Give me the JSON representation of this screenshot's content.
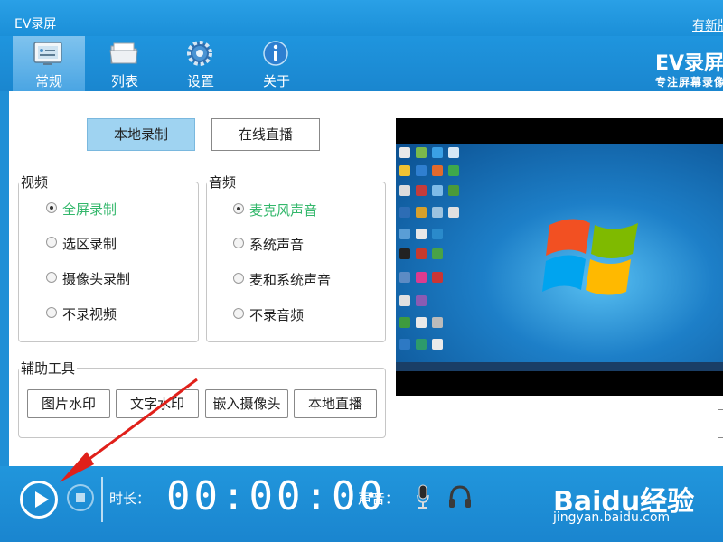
{
  "window": {
    "title": "EV录屏",
    "update_link": "有新版"
  },
  "tabs": [
    {
      "label": "常规",
      "icon": "general-icon"
    },
    {
      "label": "列表",
      "icon": "folder-icon"
    },
    {
      "label": "设置",
      "icon": "gear-icon"
    },
    {
      "label": "关于",
      "icon": "info-icon"
    }
  ],
  "brand": {
    "title": "EV录屏",
    "subtitle": "专注屏幕录像"
  },
  "mode_buttons": {
    "local": "本地录制",
    "live": "在线直播"
  },
  "video": {
    "title": "视频",
    "options": [
      "全屏录制",
      "选区录制",
      "摄像头录制",
      "不录视频"
    ],
    "selected": "全屏录制"
  },
  "audio": {
    "title": "音频",
    "options": [
      "麦克风声音",
      "系统声音",
      "麦和系统声音",
      "不录音频"
    ],
    "selected": "麦克风声音"
  },
  "tools": {
    "title": "辅助工具",
    "buttons": [
      "图片水印",
      "文字水印",
      "嵌入摄像头",
      "本地直播"
    ]
  },
  "bottom": {
    "duration_label": "时长：",
    "timer": "00:00:00",
    "sound_label": "声音："
  },
  "watermark": {
    "logo": "Baidu经验",
    "url": "jingyan.baidu.com"
  },
  "colors": {
    "accent": "#1f8fd6",
    "selected_option": "#33b76b",
    "selected_button": "#9fd3f1"
  }
}
